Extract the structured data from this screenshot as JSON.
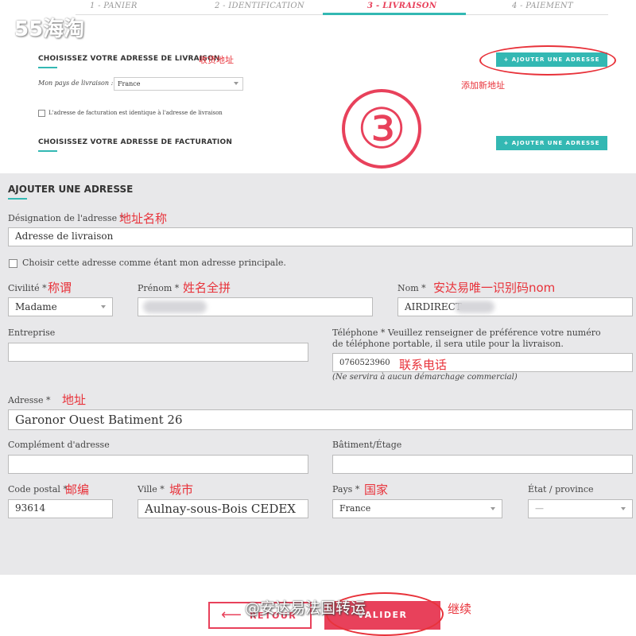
{
  "logo": "55海淘",
  "steps": [
    "1 - PANIER",
    "2 - IDENTIFICATION",
    "3 - LIVRAISON",
    "4 - PAIEMENT"
  ],
  "delivery": {
    "title": "CHOISISSEZ VOTRE ADRESSE DE LIVRAISON",
    "title_annot": "收货地址",
    "add_button": "+ AJOUTER UNE ADRESSE",
    "add_annot": "添加新地址",
    "country_label": "Mon pays de livraison :",
    "country_value": "France",
    "same_billing_label": "L'adresse de facturation est identique à l'adresse de livraison"
  },
  "step_marker": "③",
  "billing": {
    "title": "CHOISISSEZ VOTRE ADRESSE DE FACTURATION",
    "add_button": "+ AJOUTER UNE ADRESSE"
  },
  "form": {
    "title": "AJOUTER UNE ADRESSE",
    "designation_label": "Désignation de l'adresse *",
    "designation_annot": "地址名称",
    "designation_value": "Adresse de livraison",
    "principal_label": "Choisir cette adresse comme étant mon adresse principale.",
    "civilite_label": "Civilité *",
    "civilite_annot": "称谓",
    "civilite_value": "Madame",
    "prenom_label": "Prénom *",
    "prenom_annot": "姓名全拼",
    "nom_label": "Nom *",
    "nom_annot": "安达易唯一识别码nom",
    "nom_value": "AIRDIRECT",
    "entreprise_label": "Entreprise",
    "telephone_label": "Téléphone * Veuillez renseigner de préférence votre numéro de téléphone portable, il sera utile pour la livraison.",
    "telephone_value": "0760523960",
    "telephone_annot": "联系电话",
    "telephone_note": "(Ne servira à aucun démarchage commercial)",
    "adresse_label": "Adresse *",
    "adresse_annot": "地址",
    "adresse_value": "Garonor Ouest Batiment 26",
    "complement_label": "Complément d'adresse",
    "batiment_label": "Bâtiment/Étage",
    "code_postal_label": "Code postal *",
    "code_postal_annot": "邮编",
    "code_postal_value": "93614",
    "ville_label": "Ville *",
    "ville_annot": "城市",
    "ville_value": "Aulnay-sous-Bois CEDEX",
    "pays_label": "Pays *",
    "pays_annot": "国家",
    "pays_value": "France",
    "etat_label": "État / province",
    "etat_value": "—"
  },
  "footer": {
    "back_label": "RETOUR",
    "validate_label": "VALIDER",
    "continue_annot": "继续",
    "watermark": "@安达易法国转运"
  }
}
